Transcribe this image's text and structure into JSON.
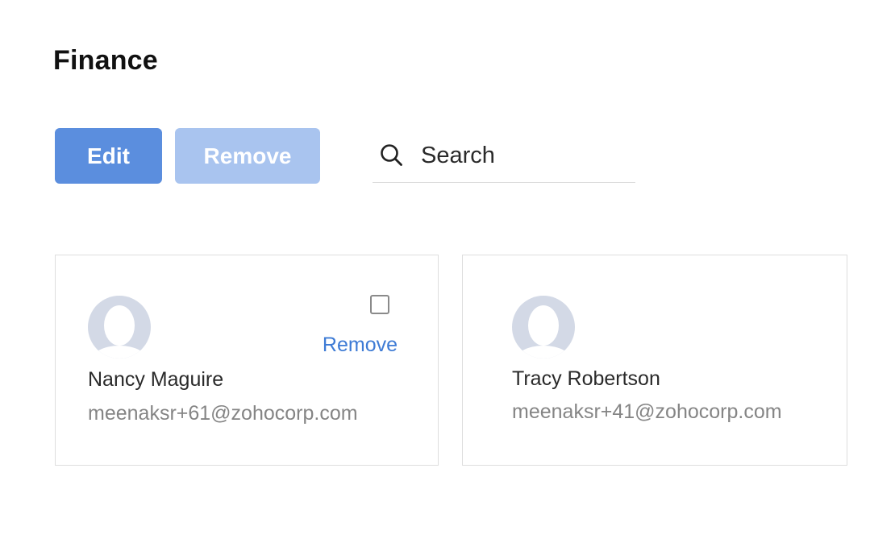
{
  "header": {
    "title": "Finance"
  },
  "toolbar": {
    "edit_label": "Edit",
    "remove_label": "Remove"
  },
  "search": {
    "placeholder": "Search",
    "value": "",
    "icon": "search-icon"
  },
  "members": [
    {
      "name": "Nancy Maguire",
      "email": "meenaksr+61@zohocorp.com",
      "remove_label": "Remove",
      "checked": false,
      "avatar_icon": "user-placeholder-icon"
    },
    {
      "name": "Tracy Robertson",
      "email": "meenaksr+41@zohocorp.com",
      "avatar_icon": "user-placeholder-icon"
    }
  ],
  "colors": {
    "primary_button": "#5b8ede",
    "disabled_button": "#a9c4ef",
    "link": "#3e7bd5",
    "avatar_bg": "#d3d9e6",
    "card_border": "#dedede"
  }
}
